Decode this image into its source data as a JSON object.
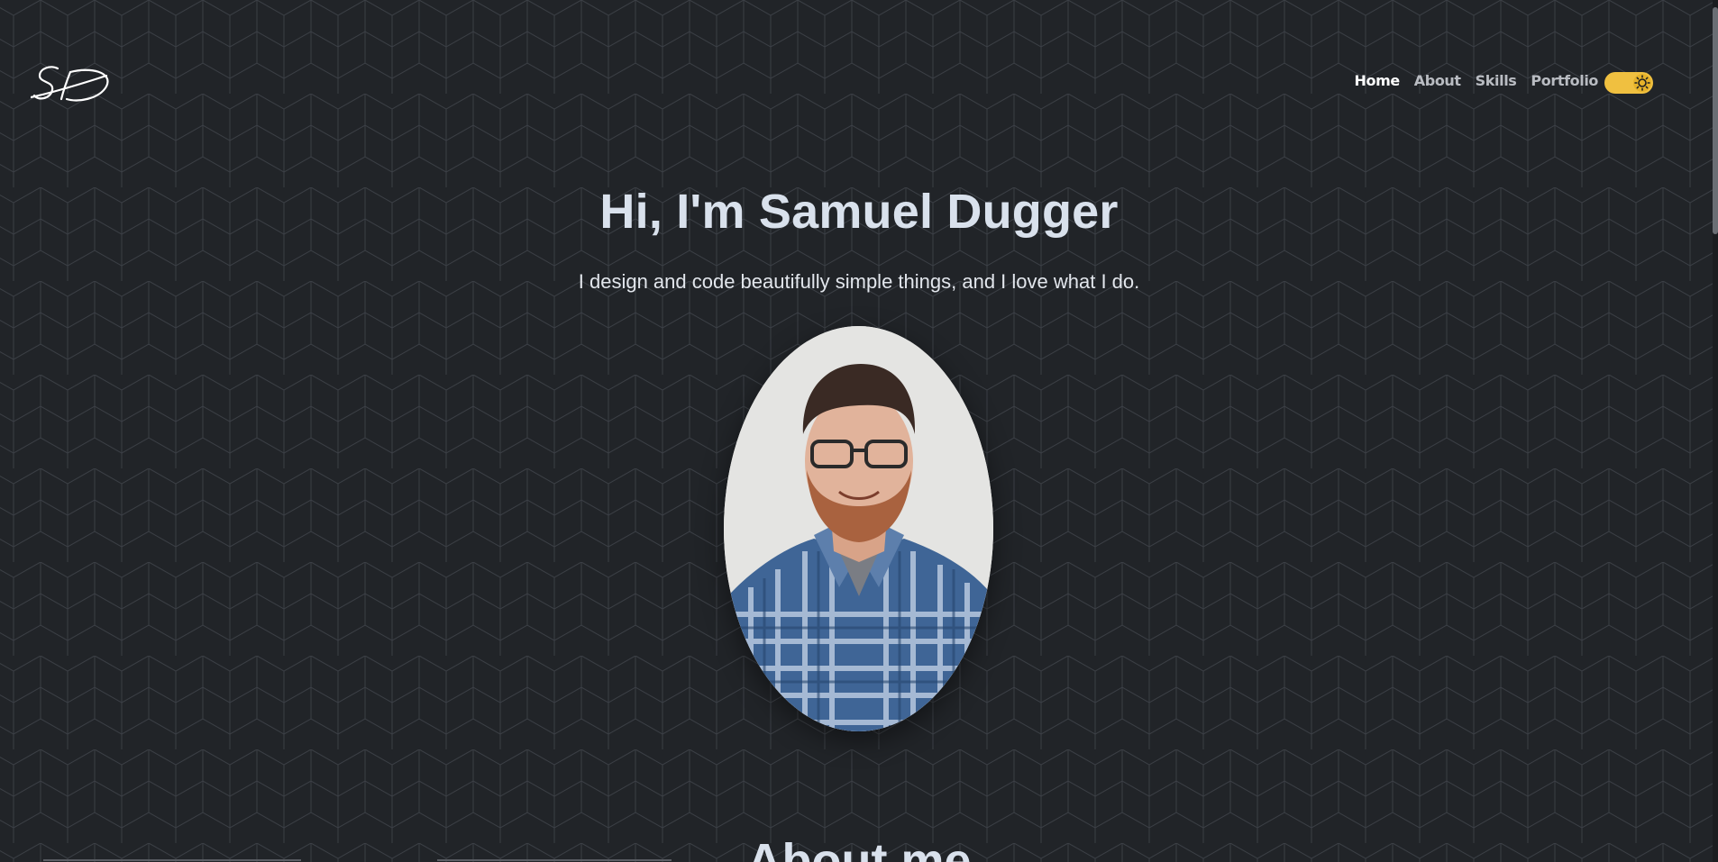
{
  "header": {
    "logo_name": "SD-signature-logo",
    "nav": [
      {
        "label": "Home",
        "active": true
      },
      {
        "label": "About",
        "active": false
      },
      {
        "label": "Skills",
        "active": false
      },
      {
        "label": "Portfolio",
        "active": false
      }
    ],
    "theme_toggle": {
      "state": "on",
      "icon": "sun-icon",
      "accent_color": "#f0c040"
    }
  },
  "hero": {
    "title": "Hi, I'm Samuel Dugger",
    "subtitle": "I design and code beautifully simple things, and I love what I do."
  },
  "next_section": {
    "title": "About me"
  },
  "colors": {
    "background": "#212428",
    "pattern_line": "#3a3e44",
    "title_text": "#d9e1ec"
  }
}
